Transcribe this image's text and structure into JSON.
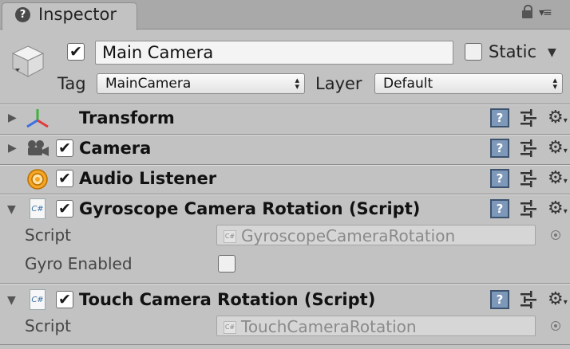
{
  "tab": {
    "title": "Inspector",
    "icon": "info-icon"
  },
  "game_object": {
    "name": "Main Camera",
    "active": true,
    "static_label": "Static",
    "static_checked": false,
    "tag_label": "Tag",
    "tag_value": "MainCamera",
    "layer_label": "Layer",
    "layer_value": "Default"
  },
  "components": [
    {
      "name": "Transform",
      "expanded": false,
      "has_toggle": false,
      "icon": "transform-axes-icon"
    },
    {
      "name": "Camera",
      "expanded": false,
      "enabled": true,
      "icon": "camera-icon"
    },
    {
      "name": "Audio Listener",
      "expanded": false,
      "enabled": true,
      "icon": "audio-listener-icon"
    },
    {
      "name": "Gyroscope Camera Rotation (Script)",
      "expanded": true,
      "enabled": true,
      "icon": "csharp-script-icon",
      "properties": [
        {
          "label": "Script",
          "value": "GyroscopeCameraRotation"
        },
        {
          "label": "Gyro Enabled",
          "checked": false
        }
      ]
    },
    {
      "name": "Touch Camera Rotation (Script)",
      "expanded": true,
      "enabled": true,
      "icon": "csharp-script-icon",
      "properties": [
        {
          "label": "Script",
          "value": "TouchCameraRotation"
        }
      ]
    }
  ],
  "glyphs": {
    "check": "✔",
    "fold_closed": "▶",
    "fold_open": "▼",
    "help": "?",
    "gear": "⚙",
    "csharp": "C#"
  },
  "colors": {
    "background": "#c2c2c2",
    "tab_bar": "#a9a9a9",
    "help_icon": "#7d98b8",
    "audio_icon": "#f5a623"
  }
}
